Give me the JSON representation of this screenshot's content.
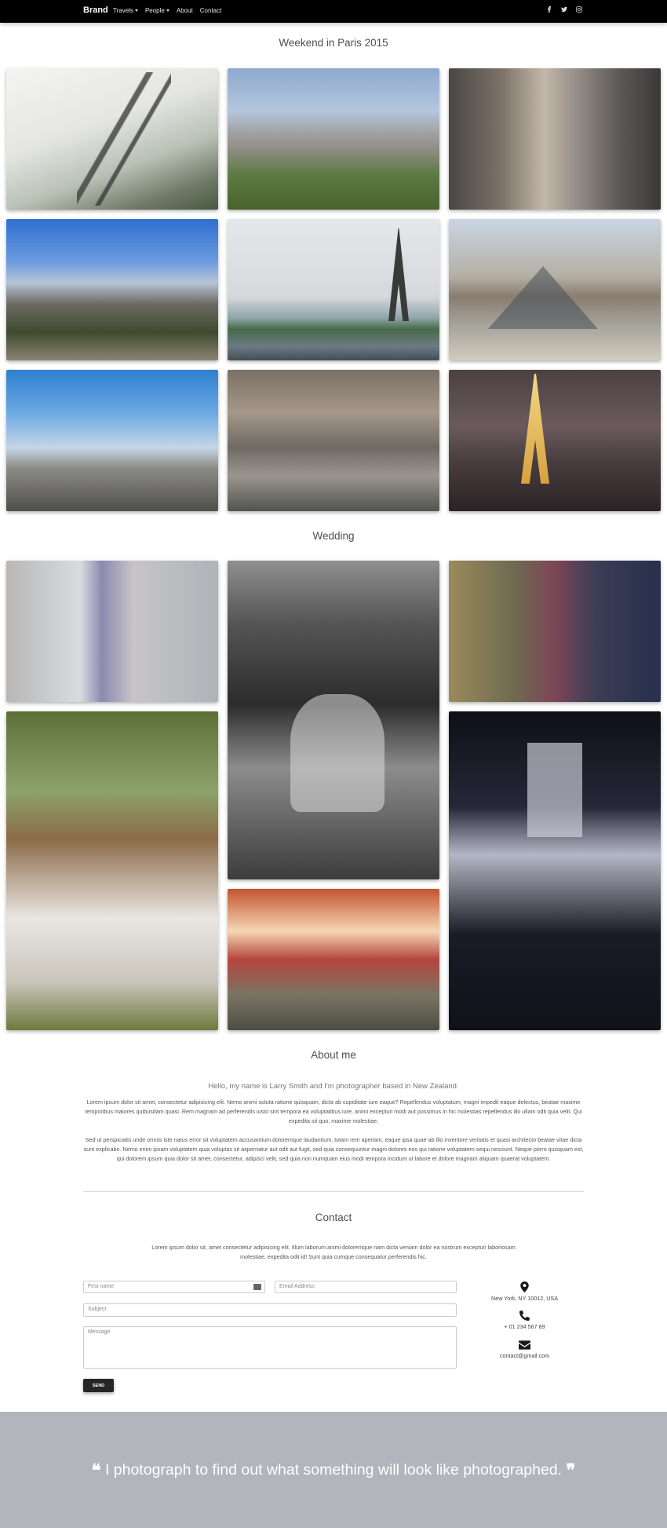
{
  "nav": {
    "brand": "Brand",
    "items": [
      "Travels",
      "People",
      "About",
      "Contact"
    ],
    "social_icons": [
      "facebook-icon",
      "twitter-icon",
      "instagram-icon"
    ]
  },
  "paris": {
    "title": "Weekend in Paris 2015",
    "photos": [
      "eiffel-tower-trees",
      "champ-de-mars-aerial",
      "paris-street",
      "notre-dame",
      "eiffel-tower-seine",
      "louvre-pyramid",
      "paris-skyline",
      "versailles-courtyard",
      "eiffel-tower-night"
    ]
  },
  "wedding": {
    "title": "Wedding",
    "photos": [
      "bride-bouquet",
      "couple-embrace-bw",
      "bouquet-hands",
      "bride-in-forest",
      "couple-walking-garden",
      "couple-silhouette-window"
    ]
  },
  "about": {
    "title": "About me",
    "lead": "Hello, my name is Larry Smith and I'm photographer based in New Zealand.",
    "paragraph1": "Lorem ipsum dolor sit amet, consectetur adipisicing elit. Nemo animi soluta ratione quisquam, dicta ab cupiditate iure eaque? Repellendus voluptatum, magni impedit eaque delectus, beatae maxime temporibus maiores quibusdam quasi. Rem magnam ad perferendis iusto sint tempora ea voluptatibus iure, animi excepturi modi aut possimus in hic molestias repellendus illo ullam odit quia velit. Qui expedita sit quo, maxime molestiae.",
    "paragraph2": "Sed ut perspiciatis unde omnis iste natus error sit voluptatem accusantium doloremque laudantium, totam rem aperiam, eaque ipsa quae ab illo inventore veritatis et quasi architecto beatae vitae dicta sunt explicabo. Nemo enim ipsam voluptatem quia voluptas sit aspernatur aut odit aut fugit, sed quia consequuntur magni dolores eos qui ratione voluptatem sequi nesciunt. Neque porro quisquam est, qui dolorem ipsum quia dolor sit amet, consectetur, adipisci velit, sed quia non numquam eius modi tempora incidunt ut labore et dolore magnam aliquam quaerat voluptatem."
  },
  "contact": {
    "title": "Contact",
    "lead": "Lorem ipsum dolor sit, amet consectetur adipisicing elit. Illum laborum animi doloremque nam dicta veniam dolor ea nostrum excepturi laboriosam molestiae, expedita odit id! Sunt quia cumque consequatur perferendis hic.",
    "first_name_placeholder": "First name",
    "email_placeholder": "Email Address",
    "subject_placeholder": "Subject",
    "message_placeholder": "Message",
    "send_label": "SEND",
    "address": "New York, NY 10012, USA",
    "phone": "+ 01 234 567 89",
    "email": "contact@gmail.com"
  },
  "quote": {
    "text": "I photograph to find out what something will look like photographed."
  },
  "colors": {
    "navbar": "#000000",
    "quote_band": "#b3b4bc",
    "send_button": "#262626"
  }
}
